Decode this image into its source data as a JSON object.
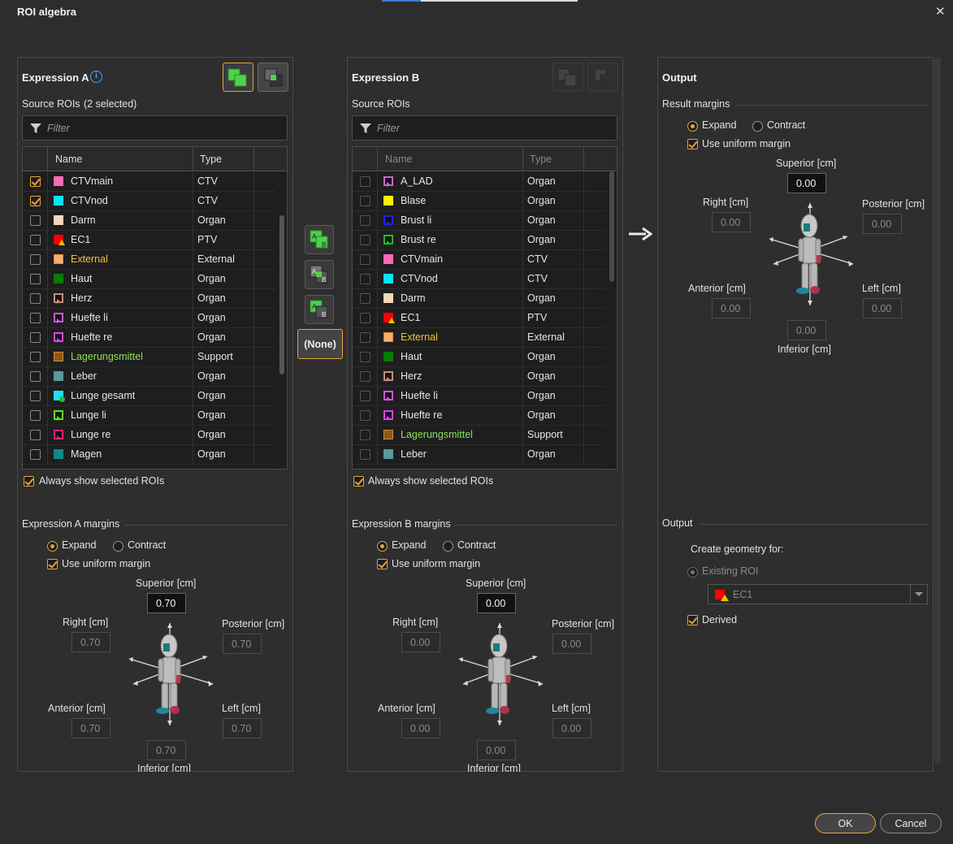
{
  "window": {
    "title": "ROI algebra",
    "close": "✕"
  },
  "expr_a": {
    "title": "Expression A",
    "source_label": "Source ROIs",
    "selected": "(2 selected)",
    "filter_placeholder": "Filter",
    "col_name": "Name",
    "col_type": "Type",
    "rows": [
      {
        "name": "CTVmain",
        "type": "CTV",
        "checked": true,
        "color": "#ff69b4"
      },
      {
        "name": "CTVnod",
        "type": "CTV",
        "checked": true,
        "color": "#00e5ff"
      },
      {
        "name": "Darm",
        "type": "Organ",
        "checked": false,
        "color": "#f5d6b8"
      },
      {
        "name": "EC1",
        "type": "PTV",
        "checked": false,
        "color": "#ff0000"
      },
      {
        "name": "External",
        "type": "External",
        "checked": false,
        "color": "#f0b070",
        "highlight": "#f0c040"
      },
      {
        "name": "Haut",
        "type": "Organ",
        "checked": false,
        "color": "#0a7a0a"
      },
      {
        "name": "Herz",
        "type": "Organ",
        "checked": false,
        "color": "#c09080"
      },
      {
        "name": "Huefte li",
        "type": "Organ",
        "checked": false,
        "color": "#cc55dd"
      },
      {
        "name": "Huefte re",
        "type": "Organ",
        "checked": false,
        "color": "#dd44ee"
      },
      {
        "name": "Lagerungsmittel",
        "type": "Support",
        "checked": false,
        "color": "#8a5a1a",
        "highlight": "#8ee05a"
      },
      {
        "name": "Leber",
        "type": "Organ",
        "checked": false,
        "color": "#5a9a9a"
      },
      {
        "name": "Lunge gesamt",
        "type": "Organ",
        "checked": false,
        "color": "#22ddee"
      },
      {
        "name": "Lunge li",
        "type": "Organ",
        "checked": false,
        "color": "#66dd22"
      },
      {
        "name": "Lunge re",
        "type": "Organ",
        "checked": false,
        "color": "#dd2277"
      },
      {
        "name": "Magen",
        "type": "Organ",
        "checked": false,
        "color": "#118888"
      }
    ],
    "always_show": "Always show selected ROIs",
    "margins_title": "Expression A margins",
    "expand": "Expand",
    "contract": "Contract",
    "uniform": "Use uniform margin",
    "superior_label": "Superior [cm]",
    "right_label": "Right [cm]",
    "posterior_label": "Posterior [cm]",
    "anterior_label": "Anterior [cm]",
    "left_label": "Left [cm]",
    "inferior_label": "Inferior [cm]",
    "superior": "0.70",
    "right": "0.70",
    "posterior": "0.70",
    "anterior": "0.70",
    "left": "0.70",
    "inferior": "0.70"
  },
  "expr_b": {
    "title": "Expression B",
    "source_label": "Source ROIs",
    "filter_placeholder": "Filter",
    "col_name": "Name",
    "col_type": "Type",
    "rows": [
      {
        "name": "A_LAD",
        "type": "Organ",
        "checked": false,
        "color": "#cc66cc"
      },
      {
        "name": "Blase",
        "type": "Organ",
        "checked": false,
        "color": "#ffee00"
      },
      {
        "name": "Brust li",
        "type": "Organ",
        "checked": false,
        "color": "#2222dd"
      },
      {
        "name": "Brust re",
        "type": "Organ",
        "checked": false,
        "color": "#22bb22"
      },
      {
        "name": "CTVmain",
        "type": "CTV",
        "checked": false,
        "color": "#ff69b4"
      },
      {
        "name": "CTVnod",
        "type": "CTV",
        "checked": false,
        "color": "#00e5ff"
      },
      {
        "name": "Darm",
        "type": "Organ",
        "checked": false,
        "color": "#f5d6b8"
      },
      {
        "name": "EC1",
        "type": "PTV",
        "checked": false,
        "color": "#ff0000"
      },
      {
        "name": "External",
        "type": "External",
        "checked": false,
        "color": "#f0b070",
        "highlight": "#f0c040"
      },
      {
        "name": "Haut",
        "type": "Organ",
        "checked": false,
        "color": "#0a7a0a"
      },
      {
        "name": "Herz",
        "type": "Organ",
        "checked": false,
        "color": "#c09080"
      },
      {
        "name": "Huefte li",
        "type": "Organ",
        "checked": false,
        "color": "#cc55dd"
      },
      {
        "name": "Huefte re",
        "type": "Organ",
        "checked": false,
        "color": "#dd44ee"
      },
      {
        "name": "Lagerungsmittel",
        "type": "Support",
        "checked": false,
        "color": "#8a5a1a",
        "highlight": "#8ee05a"
      },
      {
        "name": "Leber",
        "type": "Organ",
        "checked": false,
        "color": "#5a9a9a"
      }
    ],
    "always_show": "Always show selected ROIs",
    "margins_title": "Expression B margins",
    "expand": "Expand",
    "contract": "Contract",
    "uniform": "Use uniform margin",
    "superior_label": "Superior [cm]",
    "right_label": "Right [cm]",
    "posterior_label": "Posterior [cm]",
    "anterior_label": "Anterior [cm]",
    "left_label": "Left [cm]",
    "inferior_label": "Inferior [cm]",
    "superior": "0.00",
    "right": "0.00",
    "posterior": "0.00",
    "anterior": "0.00",
    "left": "0.00",
    "inferior": "0.00"
  },
  "ops": {
    "none_label": "(None)",
    "a": "A",
    "b": "B"
  },
  "output": {
    "title": "Output",
    "result_margins": "Result margins",
    "expand": "Expand",
    "contract": "Contract",
    "uniform": "Use uniform margin",
    "superior_label": "Superior [cm]",
    "right_label": "Right [cm]",
    "posterior_label": "Posterior [cm]",
    "anterior_label": "Anterior [cm]",
    "left_label": "Left [cm]",
    "inferior_label": "Inferior [cm]",
    "superior": "0.00",
    "right": "0.00",
    "posterior": "0.00",
    "anterior": "0.00",
    "left": "0.00",
    "inferior": "0.00",
    "output_section": "Output",
    "create_geometry": "Create geometry for:",
    "existing_roi": "Existing ROI",
    "roi_value": "EC1",
    "derived": "Derived"
  },
  "footer": {
    "ok": "OK",
    "cancel": "Cancel"
  }
}
